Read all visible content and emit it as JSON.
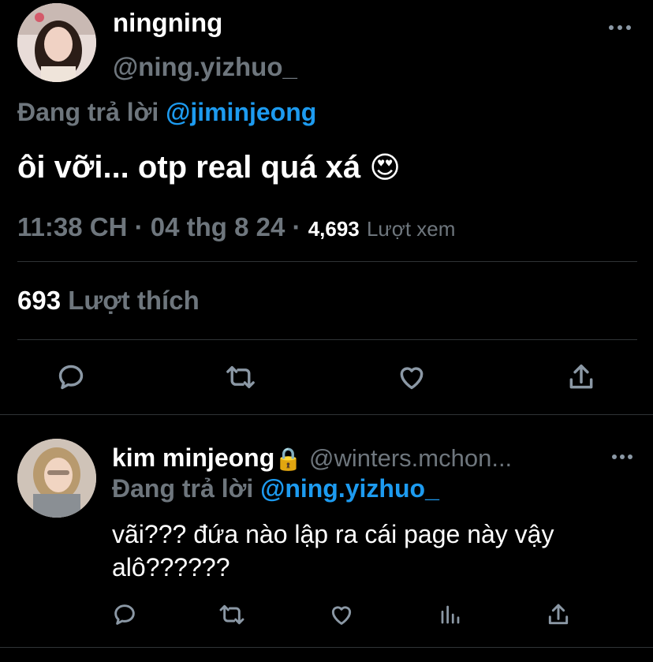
{
  "main_tweet": {
    "display_name": "ningning",
    "handle": "@ning.yizhuo_",
    "reply_prefix": "Đang trả lời",
    "reply_to": "@jiminjeong",
    "text": "ôi vỡi... otp real quá xá",
    "emoji": "😍",
    "time": "11:38 CH",
    "separator": "·",
    "date": "04 thg 8 24",
    "views_count": "4,693",
    "views_label": "Lượt xem",
    "likes_count": "693",
    "likes_label": "Lượt thích"
  },
  "reply_tweet": {
    "display_name": "kim minjeong",
    "lock_emoji": "🔒",
    "handle": "@winters.mchon...",
    "reply_prefix": "Đang trả lời",
    "reply_to": "@ning.yizhuo_",
    "text_line1": "vãi??? đứa nào lập ra cái page này vậy",
    "text_line2": "alô??????"
  },
  "icons": {
    "more": "more-horizontal-icon",
    "reply": "reply-icon",
    "retweet": "retweet-icon",
    "like": "heart-icon",
    "analytics": "analytics-icon",
    "share": "share-icon"
  },
  "colors": {
    "background": "#000000",
    "text": "#ffffff",
    "muted": "#6e767d",
    "link": "#1d9bf0",
    "divider": "#2f3336",
    "icon": "#8b98a5"
  }
}
